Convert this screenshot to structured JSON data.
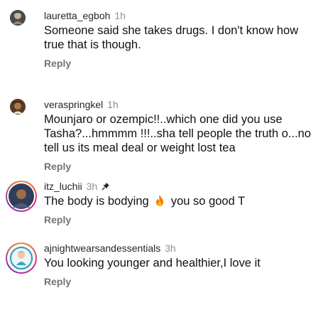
{
  "comments": [
    {
      "username": "lauretta_egboh",
      "time": "1h",
      "text": "Someone said she takes drugs. I don't know how true that is though.",
      "reply_label": "Reply",
      "avatar_icon": "profile-photo"
    },
    {
      "username": "veraspringkel",
      "time": "1h",
      "text": "Mounjaro or ozempic!!..which one did you use Tasha?...hmmmm !!!..sha tell people the truth o...no tell us its meal deal or weight lost tea",
      "reply_label": "Reply",
      "avatar_icon": "profile-photo"
    },
    {
      "username": "itz_luchii",
      "time": "3h",
      "text_before": "The body is bodying",
      "text_after": "you so good T",
      "emoji": "fire-emoji",
      "pinned_icon": "pin-icon",
      "reply_label": "Reply",
      "avatar_icon": "profile-photo-with-story-ring"
    },
    {
      "username": "ajnightwearsandessentials",
      "time": "3h",
      "text": "You looking younger and healthier,I love it",
      "reply_label": "Reply",
      "avatar_icon": "profile-photo-with-story-ring"
    }
  ],
  "colors": {
    "story_ring_start": "#f58529",
    "story_ring_mid": "#dd2a7b",
    "story_ring_end": "#8134af",
    "reply_gray": "#737373",
    "time_gray": "#8e8e8e"
  }
}
